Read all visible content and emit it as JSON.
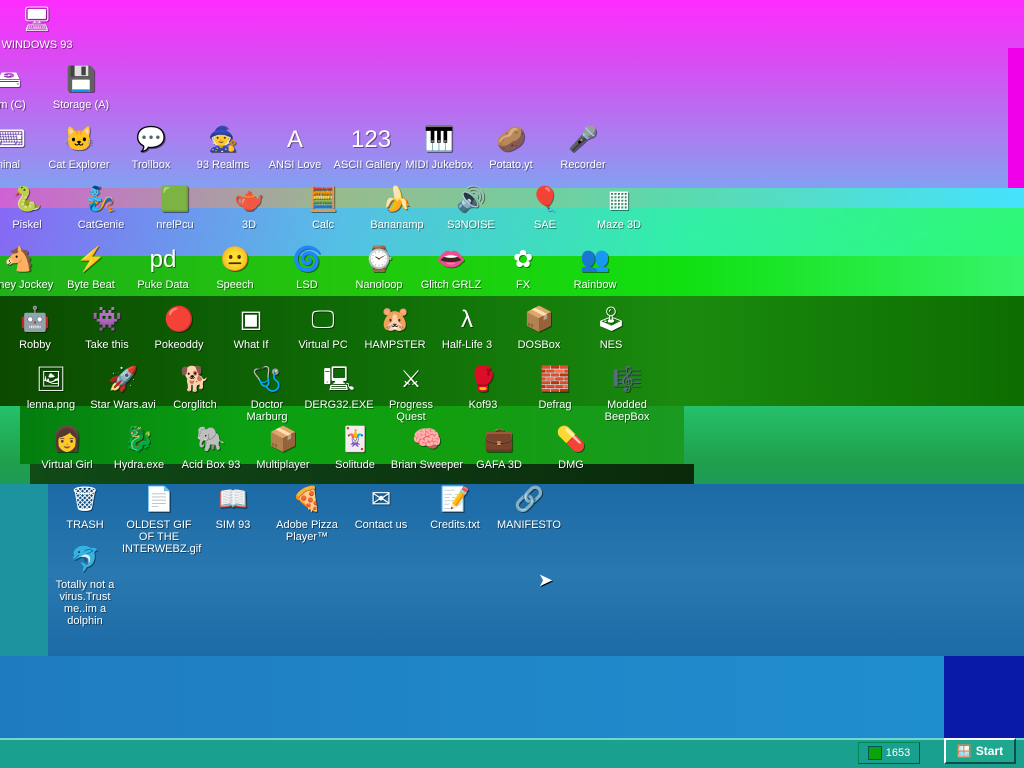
{
  "desktop": {
    "icons_row1": [
      {
        "name": "windows-93",
        "label": "WINDOWS 93",
        "glyph": "🖥"
      }
    ],
    "icons_row2": [
      {
        "name": "system-c",
        "label": "em (C)",
        "glyph": "🖴"
      },
      {
        "name": "storage-a",
        "label": "Storage (A)",
        "glyph": "💾"
      }
    ],
    "icons_row3": [
      {
        "name": "terminal",
        "label": "minal",
        "glyph": "⌨"
      },
      {
        "name": "cat-explorer",
        "label": "Cat Explorer",
        "glyph": "🐱"
      },
      {
        "name": "trollbox",
        "label": "Trollbox",
        "glyph": "💬"
      },
      {
        "name": "93-realms",
        "label": "93 Realms",
        "glyph": "🧙"
      },
      {
        "name": "ansi-love",
        "label": "ANSI Love",
        "glyph": "A"
      },
      {
        "name": "ascii-gallery",
        "label": "ASCII Gallery",
        "glyph": "123"
      },
      {
        "name": "midi-jukebox",
        "label": "MIDI Jukebox",
        "glyph": "🎹"
      },
      {
        "name": "potato-yt",
        "label": "Potato.yt",
        "glyph": "🥔"
      },
      {
        "name": "recorder",
        "label": "Recorder",
        "glyph": "🎤"
      }
    ],
    "icons_row4": [
      {
        "name": "piskel",
        "label": "Piskel",
        "glyph": "🐍"
      },
      {
        "name": "catgenie",
        "label": "CatGenie",
        "glyph": "🧞"
      },
      {
        "name": "virtual-pc-cube",
        "label": "nrelPcu",
        "glyph": "🟩"
      },
      {
        "name": "teapot",
        "label": "3D",
        "glyph": "🫖"
      },
      {
        "name": "calculator",
        "label": "Calc",
        "glyph": "🧮"
      },
      {
        "name": "bananamp",
        "label": "Bananamp",
        "glyph": "🍌"
      },
      {
        "name": "speaker",
        "label": "S3NOISE",
        "glyph": "🔊"
      },
      {
        "name": "balloon",
        "label": "SAE",
        "glyph": "🎈"
      },
      {
        "name": "maze-3d",
        "label": "Maze 3D",
        "glyph": "▦"
      }
    ],
    "icons_row5": [
      {
        "name": "poney-jockey",
        "label": "Poney Jockey",
        "glyph": "🐴"
      },
      {
        "name": "byte-beat",
        "label": "Byte Beat",
        "glyph": "⚡"
      },
      {
        "name": "puke-data",
        "label": "Puke Data",
        "glyph": "pd"
      },
      {
        "name": "speech",
        "label": "Speech",
        "glyph": "😐"
      },
      {
        "name": "lsd",
        "label": "LSD",
        "glyph": "🌀"
      },
      {
        "name": "nanoloop",
        "label": "Nanoloop",
        "glyph": "⌚"
      },
      {
        "name": "glitch-grlz",
        "label": "Glitch GRLZ",
        "glyph": "👄"
      },
      {
        "name": "fx",
        "label": "FX",
        "glyph": "✿"
      },
      {
        "name": "rainbow",
        "label": "Rainbow",
        "glyph": "👥"
      }
    ],
    "icons_row6": [
      {
        "name": "robby",
        "label": "Robby",
        "glyph": "🤖"
      },
      {
        "name": "take-this",
        "label": "Take this",
        "glyph": "👾"
      },
      {
        "name": "pokeoddy",
        "label": "Pokeoddy",
        "glyph": "🔴"
      },
      {
        "name": "what-if",
        "label": "What If",
        "glyph": "▣"
      },
      {
        "name": "virtual-pc",
        "label": "Virtual PC",
        "glyph": "🖵"
      },
      {
        "name": "hampster",
        "label": "HAMPSTER",
        "glyph": "🐹"
      },
      {
        "name": "half-life-3",
        "label": "Half-Life 3",
        "glyph": "λ"
      },
      {
        "name": "dosbox",
        "label": "DOSBox",
        "glyph": "📦"
      },
      {
        "name": "nes",
        "label": "NES",
        "glyph": "🕹"
      }
    ],
    "icons_row7": [
      {
        "name": "lenna",
        "label": "lenna.png",
        "glyph": "🖼"
      },
      {
        "name": "star-wars",
        "label": "Star Wars.avi",
        "glyph": "🚀"
      },
      {
        "name": "corglitch",
        "label": "Corglitch",
        "glyph": "🐕"
      },
      {
        "name": "doctor-marburg",
        "label": "Doctor Marburg",
        "glyph": "🩺"
      },
      {
        "name": "derg32",
        "label": "DERG32.EXE",
        "glyph": "🖳"
      },
      {
        "name": "progress-quest",
        "label": "Progress Quest",
        "glyph": "⚔"
      },
      {
        "name": "kof93",
        "label": "Kof93",
        "glyph": "🥊"
      },
      {
        "name": "defrag",
        "label": "Defrag",
        "glyph": "🧱"
      },
      {
        "name": "modded-beepbox",
        "label": "Modded BeepBox",
        "glyph": "🎼"
      }
    ],
    "icons_row8": [
      {
        "name": "virtual-girl",
        "label": "Virtual Girl",
        "glyph": "👩"
      },
      {
        "name": "hydra",
        "label": "Hydra.exe",
        "glyph": "🐉"
      },
      {
        "name": "acid-box-93",
        "label": "Acid Box 93",
        "glyph": "🐘"
      },
      {
        "name": "multi-player",
        "label": "Multiplayer",
        "glyph": "📦"
      },
      {
        "name": "solitude",
        "label": "Solitude",
        "glyph": "🃏"
      },
      {
        "name": "brian-sweeper",
        "label": "Brian Sweeper",
        "glyph": "🧠"
      },
      {
        "name": "gafa-3d",
        "label": "GAFA 3D",
        "glyph": "💼"
      },
      {
        "name": "dmg",
        "label": "DMG",
        "glyph": "💊"
      }
    ],
    "icons_row9": [
      {
        "name": "trash",
        "label": "TRASH",
        "glyph": "🗑"
      },
      {
        "name": "oldest-gif",
        "label": "OLDEST GIF OF THE INTERWEBZ.gif",
        "glyph": "📄"
      },
      {
        "name": "sim-93",
        "label": "SIM 93",
        "glyph": "📖"
      },
      {
        "name": "adobe-pizza-player",
        "label": "Adobe Pizza Player™",
        "glyph": "🍕"
      },
      {
        "name": "contact-us",
        "label": "Contact us",
        "glyph": "✉"
      },
      {
        "name": "credits",
        "label": "Credits.txt",
        "glyph": "📝"
      },
      {
        "name": "manifesto",
        "label": "MANIFESTO",
        "glyph": "🔗"
      }
    ],
    "icons_row10": [
      {
        "name": "dolphin",
        "label": "Totally not a virus.Trust me..im a dolphin",
        "glyph": "🐬"
      }
    ]
  },
  "taskbar": {
    "start_label": "Start",
    "tray_time": "1653"
  }
}
